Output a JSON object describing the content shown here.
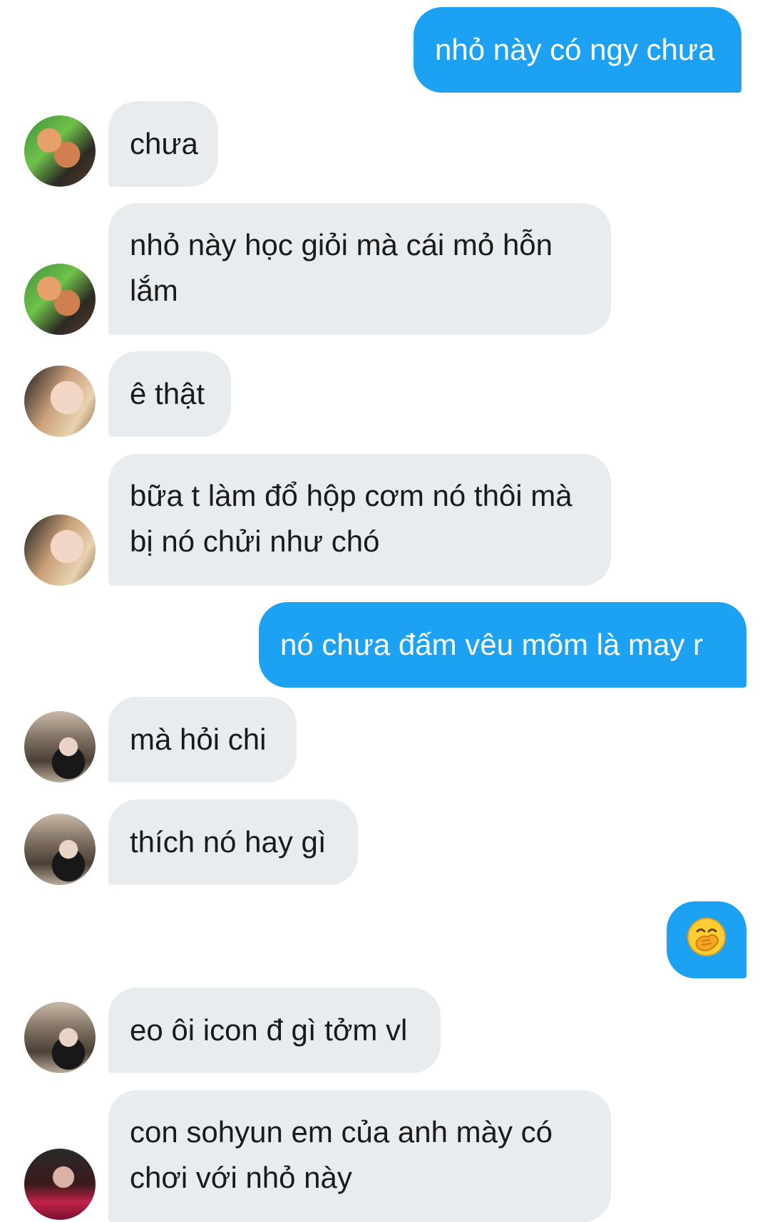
{
  "messages": [
    {
      "dir": "out",
      "text": "nhỏ này có ngy chưa"
    },
    {
      "dir": "in",
      "avatar": "avatar-green-hair",
      "text": "chưa"
    },
    {
      "dir": "in",
      "avatar": "avatar-green-hair",
      "text": "nhỏ này học giỏi mà cái mỏ hỗn lắm"
    },
    {
      "dir": "in",
      "avatar": "avatar-blonde-hair",
      "text": "ê thật"
    },
    {
      "dir": "in",
      "avatar": "avatar-blonde-hair",
      "text": "bữa t làm đổ hộp cơm nó thôi mà bị nó chửi như chó"
    },
    {
      "dir": "out",
      "text": "nó chưa đấm vêu mõm là may r"
    },
    {
      "dir": "in",
      "avatar": "avatar-dark-hair",
      "text": "mà hỏi chi"
    },
    {
      "dir": "in",
      "avatar": "avatar-dark-hair",
      "text": "thích nó hay gì"
    },
    {
      "dir": "out",
      "emoji": "face-with-hand-over-mouth-emoji"
    },
    {
      "dir": "in",
      "avatar": "avatar-dark-hair",
      "text": "eo ôi icon đ gì tởm vl"
    },
    {
      "dir": "in",
      "avatar": "avatar-red-shirt",
      "text": "con sohyun em của anh mày có chơi với nhỏ này"
    }
  ],
  "colors": {
    "outgoing_bubble": "#1da1f2",
    "incoming_bubble": "#e8ecef",
    "outgoing_text": "#ffffff",
    "incoming_text": "#1a1a1a"
  }
}
